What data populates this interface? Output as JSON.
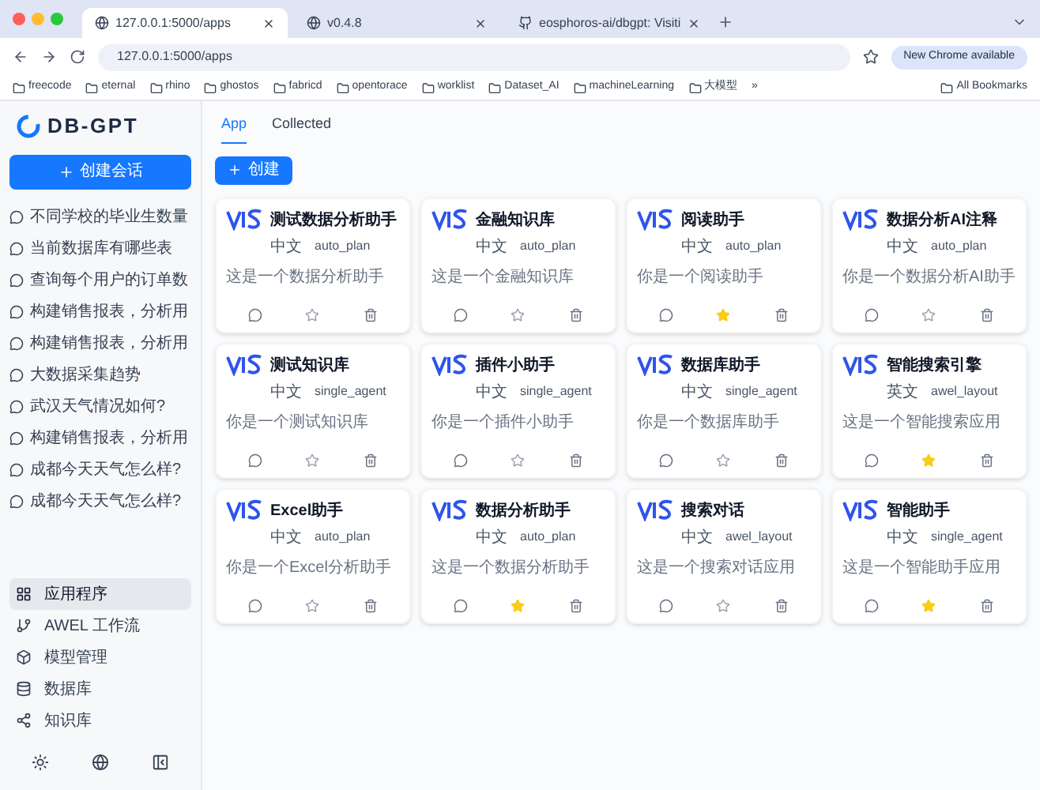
{
  "browser": {
    "tabs": [
      {
        "title": "127.0.0.1:5000/apps",
        "selected": true
      },
      {
        "title": "v0.4.8",
        "selected": false
      },
      {
        "title": "eosphoros-ai/dbgpt: Visiti",
        "selected": false
      }
    ],
    "address": "127.0.0.1:5000/apps",
    "update_badge": "New Chrome available",
    "bookmarks": [
      "freecode",
      "eternal",
      "rhino",
      "ghostos",
      "fabricd",
      "opentorace",
      "worklist",
      "Dataset_AI",
      "machineLearning",
      "大模型"
    ],
    "bookmarks_more": "»",
    "all_bookmarks": "All Bookmarks"
  },
  "sidebar": {
    "logo": "DB-GPT",
    "new_chat": "创建会话",
    "history": [
      "不同学校的毕业生数量",
      "当前数据库有哪些表",
      "查询每个用户的订单数",
      "构建销售报表，分析用",
      "构建销售报表，分析用",
      "大数据采集趋势",
      "武汉天气情况如何?",
      "构建销售报表，分析用",
      "成都今天天气怎么样?",
      "成都今天天气怎么样?"
    ],
    "nav": [
      {
        "label": "应用程序",
        "selected": true
      },
      {
        "label": "AWEL 工作流",
        "selected": false
      },
      {
        "label": "模型管理",
        "selected": false
      },
      {
        "label": "数据库",
        "selected": false
      },
      {
        "label": "知识库",
        "selected": false
      }
    ]
  },
  "tabs": [
    {
      "label": "App",
      "selected": true
    },
    {
      "label": "Collected",
      "selected": false
    }
  ],
  "create_button": "创建",
  "apps": [
    {
      "title": "测试数据分析助手",
      "language": "中文",
      "mode": "auto_plan",
      "description": "这是一个数据分析助手",
      "collected": false
    },
    {
      "title": "金融知识库",
      "language": "中文",
      "mode": "auto_plan",
      "description": "这是一个金融知识库",
      "collected": false
    },
    {
      "title": "阅读助手",
      "language": "中文",
      "mode": "auto_plan",
      "description": "你是一个阅读助手",
      "collected": true
    },
    {
      "title": "数据分析AI注释",
      "language": "中文",
      "mode": "auto_plan",
      "description": "你是一个数据分析AI助手",
      "collected": false
    },
    {
      "title": "测试知识库",
      "language": "中文",
      "mode": "single_agent",
      "description": "你是一个测试知识库",
      "collected": false
    },
    {
      "title": "插件小助手",
      "language": "中文",
      "mode": "single_agent",
      "description": "你是一个插件小助手",
      "collected": false
    },
    {
      "title": "数据库助手",
      "language": "中文",
      "mode": "single_agent",
      "description": "你是一个数据库助手",
      "collected": false
    },
    {
      "title": "智能搜索引擎",
      "language": "英文",
      "mode": "awel_layout",
      "description": "这是一个智能搜索应用",
      "collected": true
    },
    {
      "title": "Excel助手",
      "language": "中文",
      "mode": "auto_plan",
      "description": "你是一个Excel分析助手",
      "collected": false
    },
    {
      "title": "数据分析助手",
      "language": "中文",
      "mode": "auto_plan",
      "description": "这是一个数据分析助手",
      "collected": true
    },
    {
      "title": "搜索对话",
      "language": "中文",
      "mode": "awel_layout",
      "description": "这是一个搜索对话应用",
      "collected": false
    },
    {
      "title": "智能助手",
      "language": "中文",
      "mode": "single_agent",
      "description": "这是一个智能助手应用",
      "collected": true
    }
  ]
}
